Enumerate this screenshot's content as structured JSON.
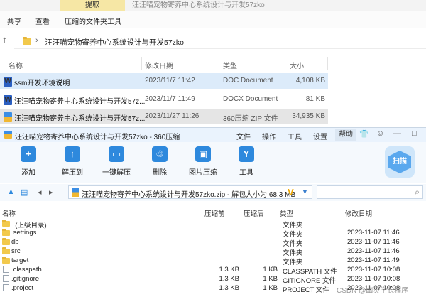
{
  "explorer": {
    "tab_extract": "提取",
    "window_title": "汪汪喵宠物寄养中心系统设计与开发57zko",
    "ribbon": [
      "共享",
      "查看",
      "压缩的文件夹工具"
    ],
    "address_path": "汪汪喵宠物寄养中心系统设计与开发57zko",
    "columns": {
      "name": "名称",
      "modified": "修改日期",
      "type": "类型",
      "size": "大小"
    },
    "files": [
      {
        "name": "ssm开发环境说明",
        "modified": "2023/11/7 11:42",
        "type": "DOC Document",
        "size": "4,108 KB",
        "icon": "word-doc-icon"
      },
      {
        "name": "汪汪喵宠物寄养中心系统设计与开发57z...",
        "modified": "2023/11/7 11:49",
        "type": "DOCX Document",
        "size": "81 KB",
        "icon": "word-doc-icon"
      },
      {
        "name": "汪汪喵宠物寄养中心系统设计与开发57z...",
        "modified": "2023/11/27 11:26",
        "type": "360压缩 ZIP 文件",
        "size": "34,935 KB",
        "icon": "zip-icon"
      }
    ]
  },
  "zip": {
    "title": "汪汪喵宠物寄养中心系统设计与开发57zko - 360压缩",
    "menu": [
      "文件",
      "操作",
      "工具",
      "设置",
      "帮助"
    ],
    "toolbar": [
      "添加",
      "解压到",
      "一键解压",
      "删除",
      "图片压缩",
      "工具"
    ],
    "scan_label": "扫描",
    "path_text": "汪汪喵宠物寄养中心系统设计与开发57zko.zip - 解包大小为 68.3 MB",
    "columns": {
      "name": "名称",
      "packed": "压缩前",
      "unpacked": "压缩后",
      "type": "类型",
      "modified": "修改日期"
    },
    "entries": [
      {
        "name": "..(上级目录)",
        "packed": "",
        "unpacked": "",
        "type": "文件夹",
        "modified": "",
        "icon": "folder-icon"
      },
      {
        "name": ".settings",
        "packed": "",
        "unpacked": "",
        "type": "文件夹",
        "modified": "2023-11-07 11:46",
        "icon": "folder-icon"
      },
      {
        "name": "db",
        "packed": "",
        "unpacked": "",
        "type": "文件夹",
        "modified": "2023-11-07 11:46",
        "icon": "folder-icon"
      },
      {
        "name": "src",
        "packed": "",
        "unpacked": "",
        "type": "文件夹",
        "modified": "2023-11-07 11:46",
        "icon": "folder-icon"
      },
      {
        "name": "target",
        "packed": "",
        "unpacked": "",
        "type": "文件夹",
        "modified": "2023-11-07 11:49",
        "icon": "folder-icon"
      },
      {
        "name": ".classpath",
        "packed": "1.3 KB",
        "unpacked": "1 KB",
        "type": "CLASSPATH 文件",
        "modified": "2023-11-07 10:08",
        "icon": "file-icon"
      },
      {
        "name": ".gitignore",
        "packed": "1.3 KB",
        "unpacked": "1 KB",
        "type": "GITIGNORE 文件",
        "modified": "2023-11-07 10:08",
        "icon": "file-icon"
      },
      {
        "name": ".project",
        "packed": "1.3 KB",
        "unpacked": "1 KB",
        "type": "PROJECT 文件",
        "modified": "2023-11-07 10:08",
        "icon": "file-icon"
      }
    ]
  },
  "watermark": "CSDN @幽灵学长程序"
}
